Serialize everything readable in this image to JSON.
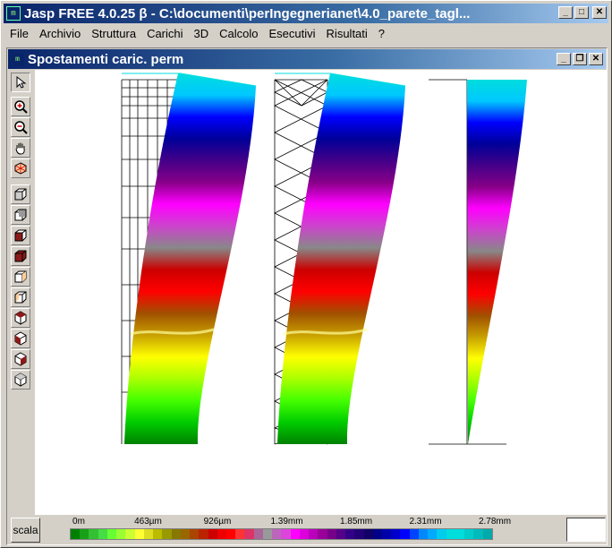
{
  "app": {
    "title": "Jasp FREE 4.0.25 β - C:\\documenti\\perIngegnerianet\\4.0_parete_tagl...",
    "icon": "jasp-app-icon",
    "min_label": "_",
    "max_label": "□",
    "close_label": "✕"
  },
  "menu": [
    "File",
    "Archivio",
    "Struttura",
    "Carichi",
    "3D",
    "Calcolo",
    "Esecutivi",
    "Risultati",
    "?"
  ],
  "child_window": {
    "title": "Spostamenti caric. perm",
    "min_label": "_",
    "restore_label": "❐",
    "close_label": "✕"
  },
  "toolbar": {
    "tools": [
      "select-arrow-icon",
      "zoom-in-icon",
      "zoom-out-icon",
      "pan-hand-icon",
      "rotate-3d-icon",
      "view-cube-front-icon",
      "view-cube-back-icon",
      "view-cube-top-icon",
      "view-cube-bottom-icon",
      "view-cube-left-icon",
      "view-cube-right-icon",
      "view-iso-1-icon",
      "view-iso-2-icon",
      "view-iso-3-icon",
      "view-iso-4-icon"
    ]
  },
  "legend": {
    "button_label": "scala",
    "tick_labels": [
      "0m",
      "463µm",
      "926µm",
      "1.39mm",
      "1.85mm",
      "2.31mm",
      "2.78mm"
    ],
    "min_mm": 0,
    "max_mm": 2.78,
    "colors": [
      "#008000",
      "#19a019",
      "#33c033",
      "#44dd44",
      "#66ff33",
      "#99ff33",
      "#ccff33",
      "#ffff33",
      "#dddd22",
      "#bbbb00",
      "#999900",
      "#887700",
      "#996600",
      "#aa4400",
      "#bb2200",
      "#cc0000",
      "#ee0000",
      "#ff0000",
      "#ff3333",
      "#dd3366",
      "#aa6699",
      "#999999",
      "#bb66bb",
      "#dd44dd",
      "#ff00ff",
      "#dd00dd",
      "#bb00bb",
      "#990099",
      "#770088",
      "#550088",
      "#330088",
      "#220077",
      "#110066",
      "#000088",
      "#0000aa",
      "#0000cc",
      "#0000ff",
      "#0044ff",
      "#0088ff",
      "#00aaff",
      "#00ccee",
      "#00dddd",
      "#00dddd",
      "#00cccc",
      "#00bbbb",
      "#00aaaa"
    ]
  },
  "color_stops": [
    "#008000",
    "#00cc00",
    "#44ff00",
    "#aaff00",
    "#ffff00",
    "#c8a000",
    "#a05000",
    "#ff0000",
    "#cc0000",
    "#888888",
    "#cc44cc",
    "#ff00ff",
    "#880088",
    "#440088",
    "#000099",
    "#0000ff",
    "#00c8ff",
    "#00dddd"
  ]
}
